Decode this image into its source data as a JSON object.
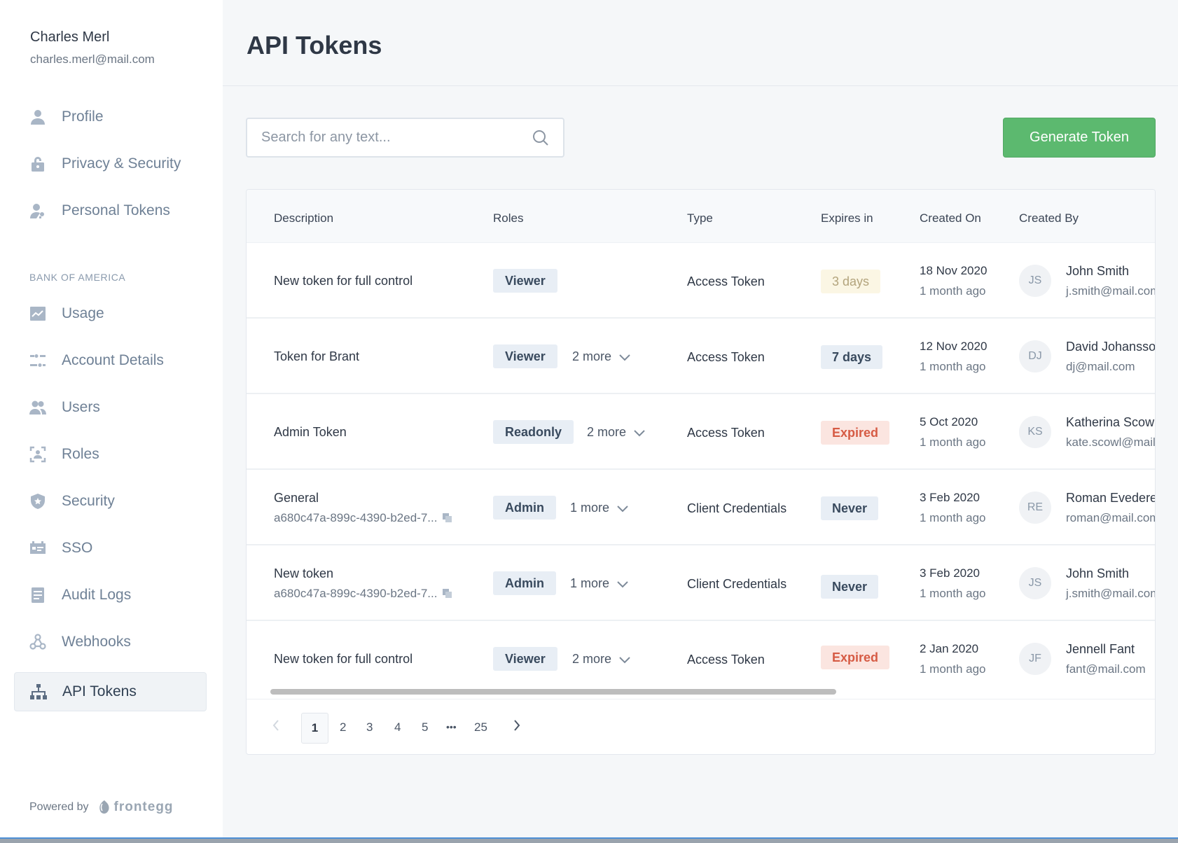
{
  "user": {
    "name": "Charles Merl",
    "email": "charles.merl@mail.com"
  },
  "nav_personal": [
    {
      "label": "Profile",
      "icon": "user-icon"
    },
    {
      "label": "Privacy & Security",
      "icon": "lock-icon"
    },
    {
      "label": "Personal Tokens",
      "icon": "user-key-icon"
    }
  ],
  "section_label": "BANK OF AMERICA",
  "nav_account": [
    {
      "label": "Usage",
      "icon": "chart-icon"
    },
    {
      "label": "Account Details",
      "icon": "sliders-icon"
    },
    {
      "label": "Users",
      "icon": "users-icon"
    },
    {
      "label": "Roles",
      "icon": "roles-icon"
    },
    {
      "label": "Security",
      "icon": "shield-icon"
    },
    {
      "label": "SSO",
      "icon": "sso-icon"
    },
    {
      "label": "Audit Logs",
      "icon": "document-icon"
    },
    {
      "label": "Webhooks",
      "icon": "webhook-icon"
    },
    {
      "label": "API Tokens",
      "icon": "api-icon",
      "active": true
    }
  ],
  "powered": {
    "text": "Powered by",
    "brand": "frontegg"
  },
  "page_title": "API Tokens",
  "search": {
    "placeholder": "Search for any text..."
  },
  "generate_button": "Generate Token",
  "columns": {
    "description": "Description",
    "roles": "Roles",
    "type": "Type",
    "expires": "Expires in",
    "created_on": "Created On",
    "created_by": "Created By"
  },
  "rows": [
    {
      "description": "New token for full control",
      "id": "",
      "role": "Viewer",
      "more": "",
      "type": "Access Token",
      "expires": "3 days",
      "expires_status": "warn",
      "created": "18 Nov 2020",
      "ago": "1 month ago",
      "initials": "JS",
      "by_name": "John Smith",
      "by_email": "j.smith@mail.com"
    },
    {
      "description": "Token for Brant",
      "id": "",
      "role": "Viewer",
      "more": "2 more",
      "type": "Access Token",
      "expires": "7 days",
      "expires_status": "info",
      "created": "12 Nov 2020",
      "ago": "1 month ago",
      "initials": "DJ",
      "by_name": "David Johansson",
      "by_email": "dj@mail.com"
    },
    {
      "description": "Admin Token",
      "id": "",
      "role": "Readonly",
      "more": "2 more",
      "type": "Access Token",
      "expires": "Expired",
      "expires_status": "bad",
      "created": "5 Oct 2020",
      "ago": "1 month ago",
      "initials": "KS",
      "by_name": "Katherina Scowl",
      "by_email": "kate.scowl@mail.com"
    },
    {
      "description": "General",
      "id": "a680c47a-899c-4390-b2ed-7...",
      "role": "Admin",
      "more": "1 more",
      "type": "Client Credentials",
      "expires": "Never",
      "expires_status": "never",
      "created": "3 Feb 2020",
      "ago": "1 month ago",
      "initials": "RE",
      "by_name": "Roman Evedere",
      "by_email": "roman@mail.com"
    },
    {
      "description": "New token",
      "id": "a680c47a-899c-4390-b2ed-7...",
      "role": "Admin",
      "more": "1 more",
      "type": "Client Credentials",
      "expires": "Never",
      "expires_status": "never",
      "created": "3 Feb 2020",
      "ago": "1 month ago",
      "initials": "JS",
      "by_name": "John Smith",
      "by_email": "j.smith@mail.com"
    },
    {
      "description": "New token for full control",
      "id": "",
      "role": "Viewer",
      "more": "2 more",
      "type": "Access Token",
      "expires": "Expired",
      "expires_status": "bad",
      "created": "2 Jan 2020",
      "ago": "1 month ago",
      "initials": "JF",
      "by_name": "Jennell Fant",
      "by_email": "fant@mail.com"
    }
  ],
  "pagination": {
    "current": "1",
    "pages": [
      "2",
      "3",
      "4",
      "5"
    ],
    "ellipsis": "•••",
    "last": "25"
  },
  "colors": {
    "accent_green": "#5cb96f",
    "expired_red": "#d65b44",
    "sidebar_text": "#6f8196"
  }
}
